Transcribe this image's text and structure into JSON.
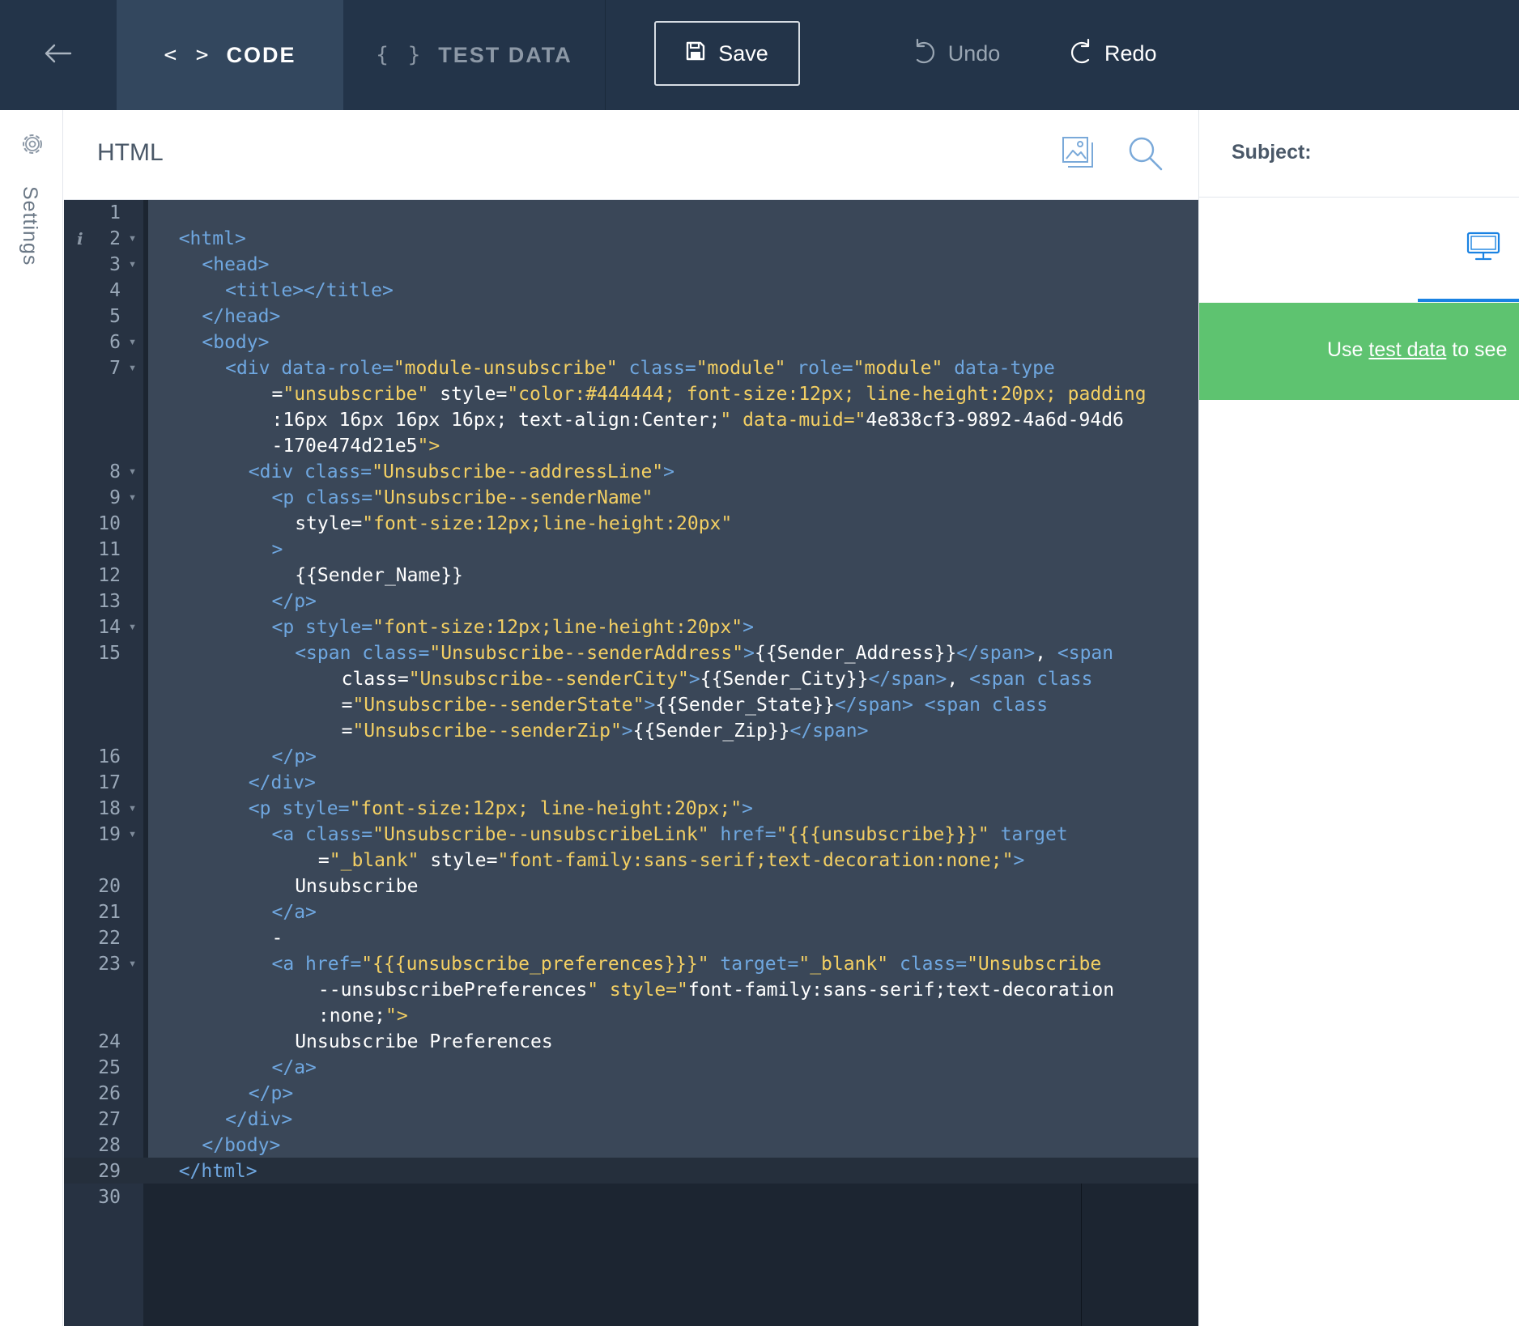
{
  "topbar": {
    "back_icon": "arrow-left-icon",
    "tabs": [
      {
        "icon": "code-icon",
        "icon_glyph": "< >",
        "label": "CODE",
        "active": true
      },
      {
        "icon": "braces-icon",
        "icon_glyph": "{ }",
        "label": "TEST DATA",
        "active": false
      }
    ],
    "save_label": "Save",
    "undo_label": "Undo",
    "redo_label": "Redo"
  },
  "settings": {
    "label": "Settings",
    "icon": "gear-icon"
  },
  "editor": {
    "title": "HTML",
    "toolbar_icons": [
      "image-icon",
      "search-icon"
    ],
    "active_line": 29,
    "colors": {
      "tag": "#6fa7e0",
      "attr_value": "#f3cf63",
      "text": "#ffffff",
      "gutter_num": "#9aa8b8",
      "selection": "#3a4758",
      "background": "#1c2531"
    },
    "lines": [
      {
        "num": "1",
        "fold": false,
        "info": "",
        "segs": [
          {
            "indent": 0,
            "text": ""
          }
        ]
      },
      {
        "num": "2",
        "fold": true,
        "info": "i",
        "segs": [
          {
            "indent": 1,
            "text": "<html>"
          }
        ]
      },
      {
        "num": "3",
        "fold": true,
        "info": "",
        "segs": [
          {
            "indent": 2,
            "text": "<head>"
          }
        ]
      },
      {
        "num": "4",
        "fold": false,
        "info": "",
        "segs": [
          {
            "indent": 3,
            "text": "<title></title>"
          }
        ]
      },
      {
        "num": "5",
        "fold": false,
        "info": "",
        "segs": [
          {
            "indent": 2,
            "text": "</head>"
          }
        ]
      },
      {
        "num": "6",
        "fold": true,
        "info": "",
        "segs": [
          {
            "indent": 2,
            "text": "<body>"
          }
        ]
      },
      {
        "num": "7",
        "fold": true,
        "info": "",
        "segs": [
          {
            "indent": 3,
            "text": "<div data-role=\"module-unsubscribe\" class=\"module\" role=\"module\" data-type"
          },
          {
            "indent": 5,
            "text": "=\"unsubscribe\" style=\"color:#444444; font-size:12px; line-height:20px; padding"
          },
          {
            "indent": 5,
            "text": ":16px 16px 16px 16px; text-align:Center;\" data-muid=\"4e838cf3-9892-4a6d-94d6"
          },
          {
            "indent": 5,
            "text": "-170e474d21e5\">"
          }
        ]
      },
      {
        "num": "8",
        "fold": true,
        "info": "",
        "segs": [
          {
            "indent": 4,
            "text": "<div class=\"Unsubscribe--addressLine\">"
          }
        ]
      },
      {
        "num": "9",
        "fold": true,
        "info": "",
        "segs": [
          {
            "indent": 5,
            "text": "<p class=\"Unsubscribe--senderName\""
          }
        ]
      },
      {
        "num": "10",
        "fold": false,
        "info": "",
        "segs": [
          {
            "indent": 6,
            "text": "style=\"font-size:12px;line-height:20px\""
          }
        ]
      },
      {
        "num": "11",
        "fold": false,
        "info": "",
        "segs": [
          {
            "indent": 5,
            "text": ">"
          }
        ]
      },
      {
        "num": "12",
        "fold": false,
        "info": "",
        "segs": [
          {
            "indent": 6,
            "text": "{{Sender_Name}}"
          }
        ]
      },
      {
        "num": "13",
        "fold": false,
        "info": "",
        "segs": [
          {
            "indent": 5,
            "text": "</p>"
          }
        ]
      },
      {
        "num": "14",
        "fold": true,
        "info": "",
        "segs": [
          {
            "indent": 5,
            "text": "<p style=\"font-size:12px;line-height:20px\">"
          }
        ]
      },
      {
        "num": "15",
        "fold": false,
        "info": "",
        "segs": [
          {
            "indent": 6,
            "text": "<span class=\"Unsubscribe--senderAddress\">{{Sender_Address}}</span>, <span"
          },
          {
            "indent": 8,
            "text": "class=\"Unsubscribe--senderCity\">{{Sender_City}}</span>, <span class"
          },
          {
            "indent": 8,
            "text": "=\"Unsubscribe--senderState\">{{Sender_State}}</span> <span class"
          },
          {
            "indent": 8,
            "text": "=\"Unsubscribe--senderZip\">{{Sender_Zip}}</span>"
          }
        ]
      },
      {
        "num": "16",
        "fold": false,
        "info": "",
        "segs": [
          {
            "indent": 5,
            "text": "</p>"
          }
        ]
      },
      {
        "num": "17",
        "fold": false,
        "info": "",
        "segs": [
          {
            "indent": 4,
            "text": "</div>"
          }
        ]
      },
      {
        "num": "18",
        "fold": true,
        "info": "",
        "segs": [
          {
            "indent": 4,
            "text": "<p style=\"font-size:12px; line-height:20px;\">"
          }
        ]
      },
      {
        "num": "19",
        "fold": true,
        "info": "",
        "segs": [
          {
            "indent": 5,
            "text": "<a class=\"Unsubscribe--unsubscribeLink\" href=\"{{{unsubscribe}}}\" target"
          },
          {
            "indent": 7,
            "text": "=\"_blank\" style=\"font-family:sans-serif;text-decoration:none;\">"
          }
        ]
      },
      {
        "num": "20",
        "fold": false,
        "info": "",
        "segs": [
          {
            "indent": 6,
            "text": "Unsubscribe"
          }
        ]
      },
      {
        "num": "21",
        "fold": false,
        "info": "",
        "segs": [
          {
            "indent": 5,
            "text": "</a>"
          }
        ]
      },
      {
        "num": "22",
        "fold": false,
        "info": "",
        "segs": [
          {
            "indent": 5,
            "text": "-"
          }
        ]
      },
      {
        "num": "23",
        "fold": true,
        "info": "",
        "segs": [
          {
            "indent": 5,
            "text": "<a href=\"{{{unsubscribe_preferences}}}\" target=\"_blank\" class=\"Unsubscribe"
          },
          {
            "indent": 7,
            "text": "--unsubscribePreferences\" style=\"font-family:sans-serif;text-decoration"
          },
          {
            "indent": 7,
            "text": ":none;\">"
          }
        ]
      },
      {
        "num": "24",
        "fold": false,
        "info": "",
        "segs": [
          {
            "indent": 6,
            "text": "Unsubscribe Preferences"
          }
        ]
      },
      {
        "num": "25",
        "fold": false,
        "info": "",
        "segs": [
          {
            "indent": 5,
            "text": "</a>"
          }
        ]
      },
      {
        "num": "26",
        "fold": false,
        "info": "",
        "segs": [
          {
            "indent": 4,
            "text": "</p>"
          }
        ]
      },
      {
        "num": "27",
        "fold": false,
        "info": "",
        "segs": [
          {
            "indent": 3,
            "text": "</div>"
          }
        ]
      },
      {
        "num": "28",
        "fold": false,
        "info": "",
        "segs": [
          {
            "indent": 2,
            "text": "</body>"
          }
        ]
      },
      {
        "num": "29",
        "fold": false,
        "info": "",
        "segs": [
          {
            "indent": 1,
            "text": "</html>"
          }
        ]
      },
      {
        "num": "30",
        "fold": false,
        "info": "",
        "segs": [
          {
            "indent": 0,
            "text": ""
          }
        ]
      }
    ]
  },
  "preview": {
    "subject_label": "Subject:",
    "view_icon": "desktop-icon",
    "notice": {
      "before": "Use ",
      "link": "test data",
      "after": " to see"
    },
    "colors": {
      "notice_bg": "#5ec370",
      "accent": "#1a82e2"
    }
  },
  "colors": {
    "topbar": "#233449",
    "active_tab": "#33475e"
  }
}
